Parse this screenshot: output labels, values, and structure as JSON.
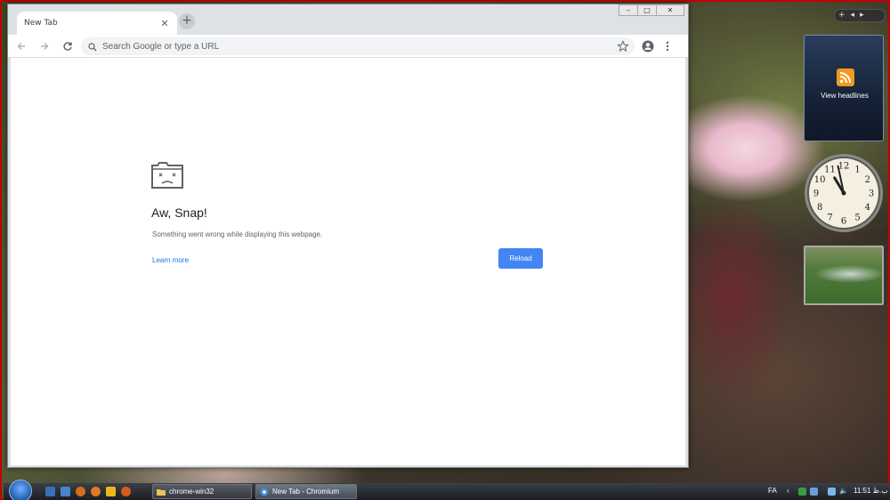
{
  "browser": {
    "tab_title": "New Tab",
    "tab_close_glyph": "✕",
    "new_tab_glyph": "+",
    "window_controls": [
      "–",
      "□",
      "✕"
    ],
    "omnibox_placeholder": "Search Google or type a URL"
  },
  "page": {
    "title": "Aw, Snap!",
    "message": "Something went wrong while displaying this webpage.",
    "learn_more": "Learn more",
    "reload_label": "Reload"
  },
  "sidebar": {
    "controls": [
      "+",
      "◂",
      "▸"
    ],
    "feed_label": "View headlines",
    "clock": {
      "hour": 10,
      "minute": 58
    },
    "clock_numerals": [
      "12",
      "1",
      "2",
      "3",
      "4",
      "5",
      "6",
      "7",
      "8",
      "9",
      "10",
      "11"
    ]
  },
  "taskbar": {
    "buttons": [
      {
        "label": "chrome-win32",
        "icon": "folder-icon"
      },
      {
        "label": "New Tab - Chromium",
        "icon": "chromium-icon"
      }
    ],
    "language": "FA",
    "time": "11:51 ب.ظ"
  },
  "colors": {
    "accent": "#1a73e8",
    "reload_button": "#4285f4",
    "feed_icon": "#f39a1c",
    "desktop_border": "#c40000"
  }
}
